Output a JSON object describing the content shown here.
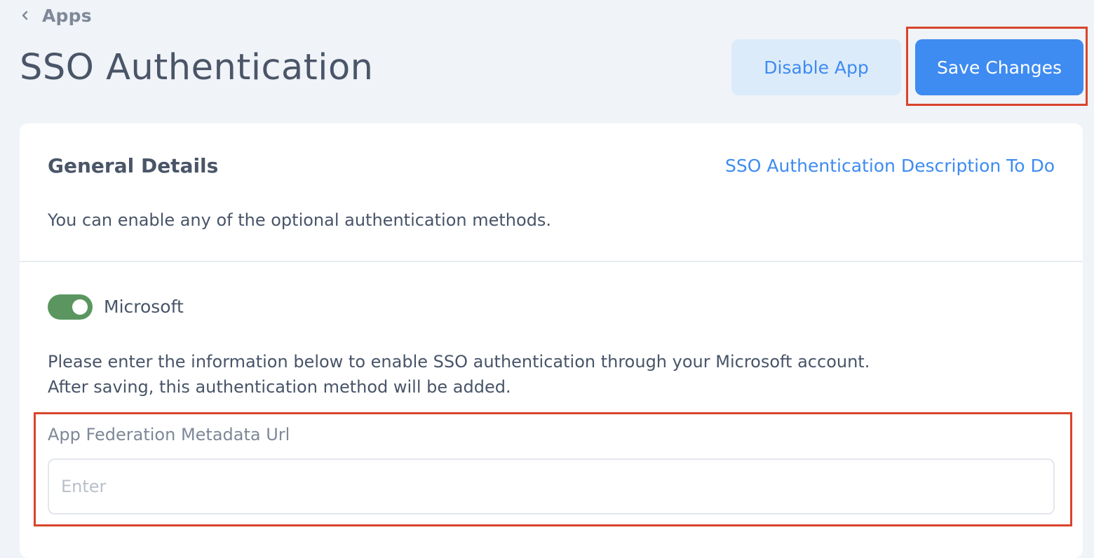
{
  "breadcrumb": {
    "label": "Apps",
    "icon": "chevron-left-icon"
  },
  "header": {
    "title": "SSO Authentication",
    "disable_label": "Disable App",
    "save_label": "Save Changes"
  },
  "general": {
    "title": "General Details",
    "link_text": "SSO Authentication Description To Do",
    "description": "You can enable any of the optional authentication methods."
  },
  "microsoft": {
    "label": "Microsoft",
    "enabled": true,
    "instruction_line1": "Please enter the information below to enable SSO authentication through your Microsoft account.",
    "instruction_line2": "After saving, this authentication method will be added.",
    "field_label": "App Federation Metadata Url",
    "field_value": "",
    "field_placeholder": "Enter"
  },
  "colors": {
    "accent": "#3e8bf1",
    "toggle_on": "#5b9660",
    "highlight": "#d9442c",
    "background": "#f0f3f7"
  }
}
